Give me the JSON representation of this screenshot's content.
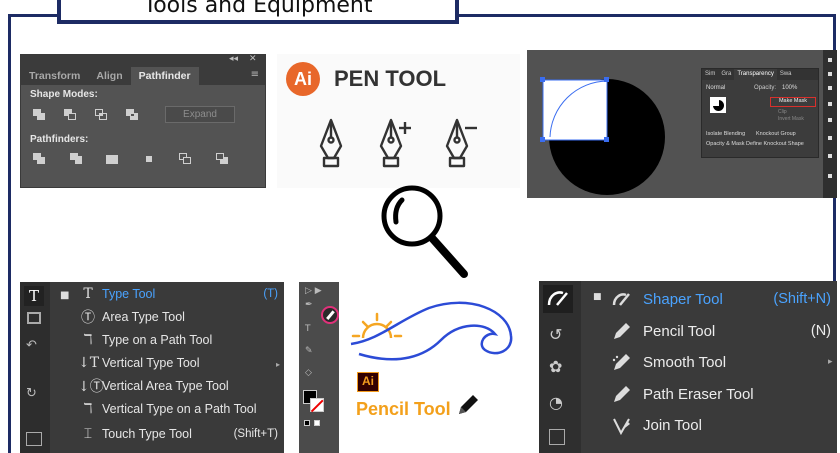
{
  "title": "Tools and Equipment",
  "pathfinder": {
    "window_controls": [
      "◂◂",
      "✕"
    ],
    "tabs": [
      "Transform",
      "Align",
      "Pathfinder"
    ],
    "menu_icon": "≡",
    "shape_modes_label": "Shape Modes:",
    "expand_label": "Expand",
    "pathfinders_label": "Pathfinders:"
  },
  "pen": {
    "logo": "Ai",
    "heading": "PEN TOOL",
    "icons": [
      "pen-icon",
      "add-anchor-pen-icon",
      "delete-anchor-pen-icon"
    ]
  },
  "transparency": {
    "tabs": [
      "Sim",
      "Gra",
      "Transparency",
      "Swa"
    ],
    "blend_mode": "Normal",
    "opacity_label": "Opacity:",
    "opacity_value": "100%",
    "buttons": [
      "Make Mask",
      "Clip",
      "Invert Mask"
    ],
    "options": [
      "Isolate Blending",
      "Knockout Group",
      "Opacity & Mask Define Knockout Shape"
    ]
  },
  "type_menu": {
    "items": [
      {
        "glyph": "T",
        "label": "Type Tool",
        "shortcut": "(T)",
        "active": true
      },
      {
        "glyph": "Ⓣ",
        "label": "Area Type Tool",
        "shortcut": ""
      },
      {
        "glyph": "ℸ",
        "label": "Type on a Path Tool",
        "shortcut": ""
      },
      {
        "glyph": "↓T",
        "label": "Vertical Type Tool",
        "shortcut": ""
      },
      {
        "glyph": "↓Ⓣ",
        "label": "Vertical Area Type Tool",
        "shortcut": ""
      },
      {
        "glyph": "ℸ",
        "label": "Vertical Type on a Path Tool",
        "shortcut": ""
      },
      {
        "glyph": "⌶",
        "label": "Touch Type Tool",
        "shortcut": "(Shift+T)"
      }
    ]
  },
  "pencil": {
    "logo": "Ai",
    "label": "Pencil Tool"
  },
  "shaper_menu": {
    "items": [
      {
        "label": "Shaper Tool",
        "shortcut": "(Shift+N)",
        "active": true
      },
      {
        "label": "Pencil Tool",
        "shortcut": "(N)"
      },
      {
        "label": "Smooth Tool",
        "shortcut": ""
      },
      {
        "label": "Path Eraser Tool",
        "shortcut": ""
      },
      {
        "label": "Join Tool",
        "shortcut": ""
      }
    ]
  },
  "colors": {
    "frame": "#1d2b64",
    "accent_orange": "#e8672a",
    "highlight_blue": "#4aa3ff",
    "mask_red": "#d9302c"
  }
}
